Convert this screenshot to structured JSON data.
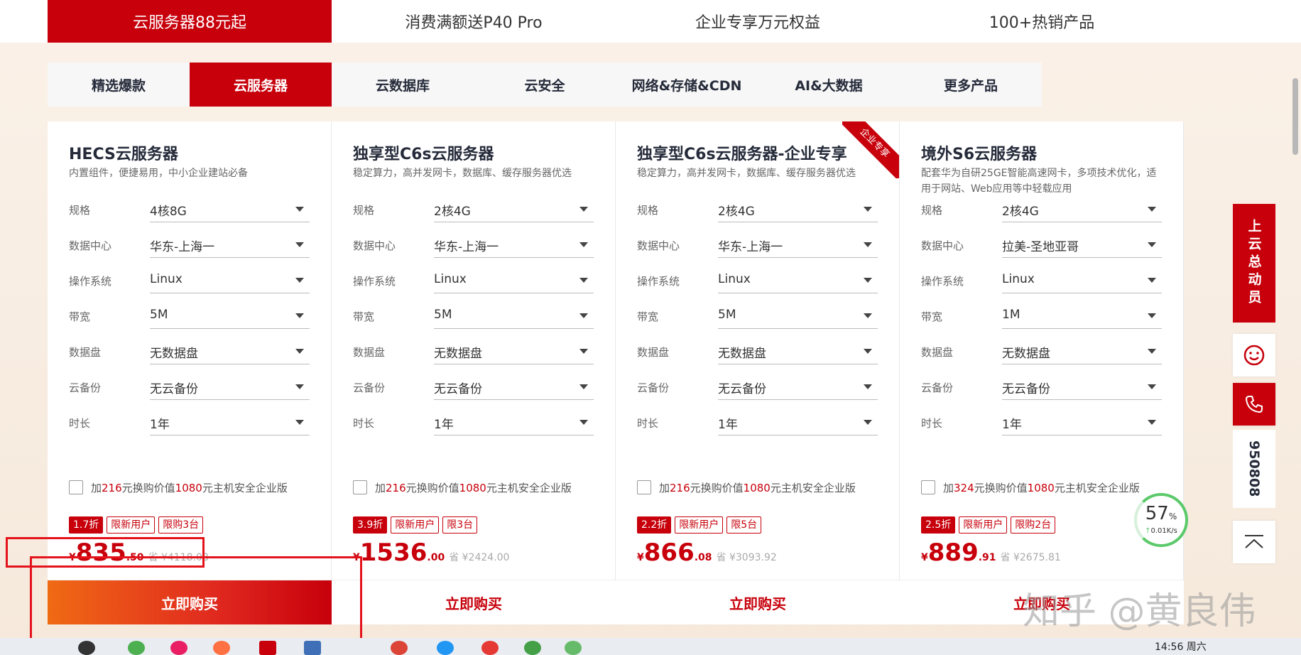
{
  "top_tabs": [
    "云服务器88元起",
    "消费满额送P40 Pro",
    "企业专享万元权益",
    "100+热销产品"
  ],
  "category_tabs": [
    "精选爆款",
    "云服务器",
    "云数据库",
    "云安全",
    "网络&存储&CDN",
    "AI&大数据",
    "更多产品"
  ],
  "option_labels": [
    "规格",
    "数据中心",
    "操作系统",
    "带宽",
    "数据盘",
    "云备份",
    "时长"
  ],
  "cards": [
    {
      "title": "HECS云服务器",
      "desc": "内置组件，便捷易用，中小企业建站必备",
      "ribbon": "",
      "options": [
        "4核8G",
        "华东-上海一",
        "Linux",
        "5M",
        "无数据盘",
        "无云备份",
        "1年"
      ],
      "addon_pre": "加",
      "addon_price": "216",
      "addon_mid": "元换购价值",
      "addon_value": "1080",
      "addon_post": "元主机安全企业版",
      "discount": "1.7折",
      "limit_user": "限新用户",
      "limit_qty": "限购3台",
      "yen": "¥",
      "price_int": "835",
      "price_dec": ".50",
      "save": "省 ¥4118.08",
      "buy": "立即购买"
    },
    {
      "title": "独享型C6s云服务器",
      "desc": "稳定算力，高并发网卡，数据库、缓存服务器优选",
      "ribbon": "",
      "options": [
        "2核4G",
        "华东-上海一",
        "Linux",
        "5M",
        "无数据盘",
        "无云备份",
        "1年"
      ],
      "addon_pre": "加",
      "addon_price": "216",
      "addon_mid": "元换购价值",
      "addon_value": "1080",
      "addon_post": "元主机安全企业版",
      "discount": "3.9折",
      "limit_user": "限新用户",
      "limit_qty": "限3台",
      "yen": "¥",
      "price_int": "1536",
      "price_dec": ".00",
      "save": "省 ¥2424.00",
      "buy": "立即购买"
    },
    {
      "title": "独享型C6s云服务器-企业专享",
      "desc": "稳定算力，高并发网卡，数据库、缓存服务器优选",
      "ribbon": "企业专享",
      "options": [
        "2核4G",
        "华东-上海一",
        "Linux",
        "5M",
        "无数据盘",
        "无云备份",
        "1年"
      ],
      "addon_pre": "加",
      "addon_price": "216",
      "addon_mid": "元换购价值",
      "addon_value": "1080",
      "addon_post": "元主机安全企业版",
      "discount": "2.2折",
      "limit_user": "限新用户",
      "limit_qty": "限5台",
      "yen": "¥",
      "price_int": "866",
      "price_dec": ".08",
      "save": "省 ¥3093.92",
      "buy": "立即购买"
    },
    {
      "title": "境外S6云服务器",
      "desc": "配套华为自研25GE智能高速网卡，多项技术优化，适用于网站、Web应用等中轻载应用",
      "ribbon": "",
      "options": [
        "2核4G",
        "拉美-圣地亚哥",
        "Linux",
        "1M",
        "无数据盘",
        "无云备份",
        "1年"
      ],
      "addon_pre": "加",
      "addon_price": "324",
      "addon_mid": "元换购价值",
      "addon_value": "1080",
      "addon_post": "元主机安全企业版",
      "discount": "2.5折",
      "limit_user": "限新用户",
      "limit_qty": "限购2台",
      "yen": "¥",
      "price_int": "889",
      "price_dec": ".91",
      "save": "省 ¥2675.81",
      "buy": "立即购买"
    }
  ],
  "float_bar": {
    "campaign": "上云总动员",
    "phone": "950808"
  },
  "speed_widget": {
    "percent": "57",
    "unit": "%",
    "rate": "0.01K/s"
  },
  "watermark": "知乎 @黄良伟",
  "taskbar": {
    "clock": "14:56 周六"
  },
  "colors": {
    "brand_red": "#c7000b",
    "annotation_red": "#e4131b"
  }
}
